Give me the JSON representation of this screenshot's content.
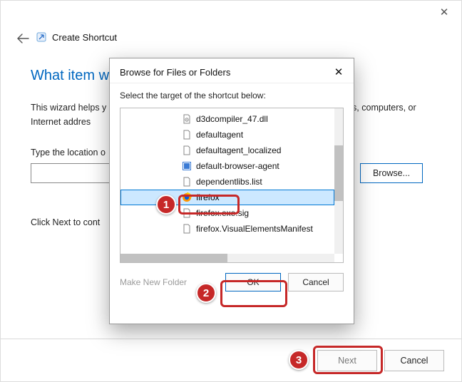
{
  "main": {
    "title": "Create Shortcut",
    "heading": "What item wo",
    "wizard_text_pre": "This wizard helps y",
    "wizard_text_post": "olders, computers, or Internet addres",
    "location_label": "Type the location o",
    "browse": "Browse...",
    "click_next": "Click Next to cont",
    "next": "Next",
    "cancel": "Cancel"
  },
  "dialog": {
    "title": "Browse for Files or Folders",
    "instruction": "Select the target of the shortcut below:",
    "files": [
      {
        "name": "d3dcompiler_47.dll",
        "icon": "dll"
      },
      {
        "name": "defaultagent",
        "icon": "file"
      },
      {
        "name": "defaultagent_localized",
        "icon": "file"
      },
      {
        "name": "default-browser-agent",
        "icon": "exe"
      },
      {
        "name": "dependentlibs.list",
        "icon": "file"
      },
      {
        "name": "firefox",
        "icon": "firefox",
        "selected": true
      },
      {
        "name": "firefox.exe.sig",
        "icon": "file"
      },
      {
        "name": "firefox.VisualElementsManifest",
        "icon": "file"
      }
    ],
    "make_new_folder": "Make New Folder",
    "ok": "OK",
    "cancel": "Cancel"
  },
  "annotations": {
    "a1": "1",
    "a2": "2",
    "a3": "3"
  }
}
